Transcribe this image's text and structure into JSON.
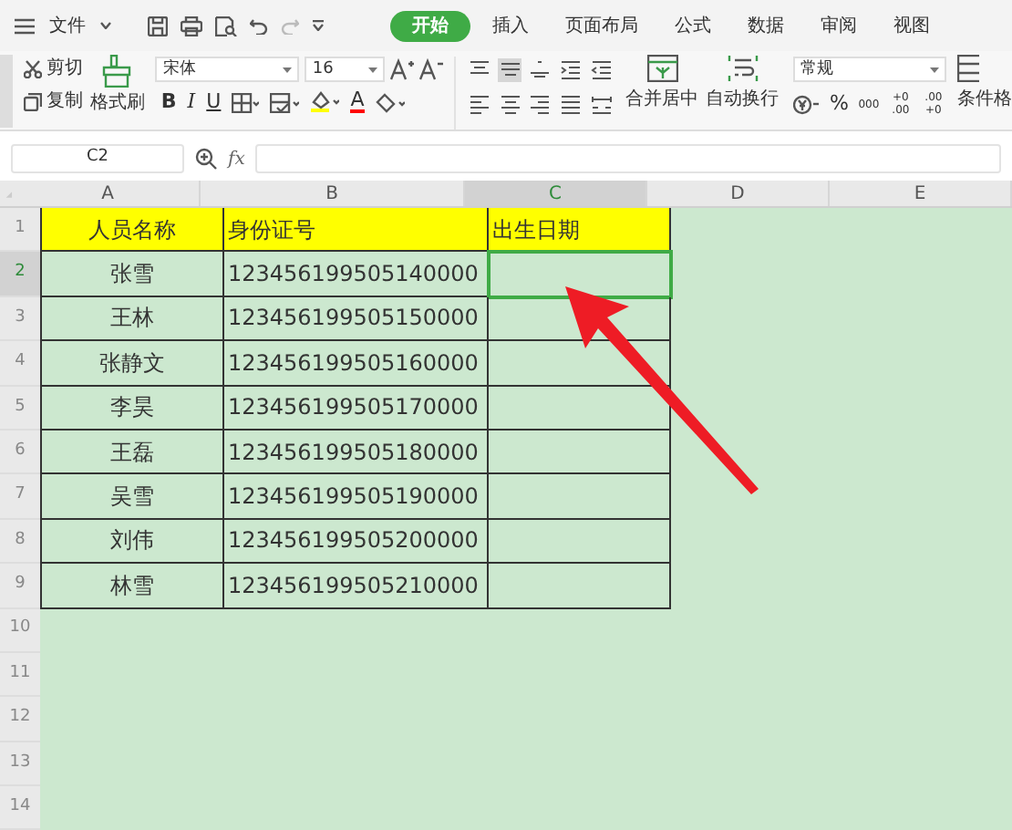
{
  "menu": {
    "file": "文件"
  },
  "tabs": [
    {
      "label": "开始",
      "selected": true
    },
    {
      "label": "插入",
      "selected": false
    },
    {
      "label": "页面布局",
      "selected": false
    },
    {
      "label": "公式",
      "selected": false
    },
    {
      "label": "数据",
      "selected": false
    },
    {
      "label": "审阅",
      "selected": false
    },
    {
      "label": "视图",
      "selected": false
    }
  ],
  "ribbon": {
    "cut": "剪切",
    "copy": "复制",
    "format_painter": "格式刷",
    "font": "宋体",
    "font_size": "16",
    "bold": "B",
    "italic": "I",
    "underline": "U",
    "font_color": "A",
    "align_buttons": [
      {
        "selected": false
      },
      {
        "selected": true
      },
      {
        "selected": false
      },
      {
        "selected": false
      },
      {
        "selected": false
      },
      {
        "selected": false
      },
      {
        "selected": false
      },
      {
        "selected": false
      },
      {
        "selected": false
      },
      {
        "selected": false
      }
    ],
    "merge": "合并居中",
    "wrap": "自动换行",
    "number_format": "常规",
    "percent": "%",
    "thousands": "000",
    "increase_decimal": "+0 .00",
    "decrease_decimal": ".00 +0",
    "conditional": "条件格"
  },
  "name_box": "C2",
  "fx": "fx",
  "columns": [
    {
      "label": "A",
      "selected": false
    },
    {
      "label": "B",
      "selected": false
    },
    {
      "label": "C",
      "selected": true
    },
    {
      "label": "D",
      "selected": false
    },
    {
      "label": "E",
      "selected": false
    }
  ],
  "row_numbers": [
    {
      "label": "1",
      "selected": false
    },
    {
      "label": "2",
      "selected": true
    },
    {
      "label": "3",
      "selected": false
    },
    {
      "label": "4",
      "selected": false
    },
    {
      "label": "5",
      "selected": false
    },
    {
      "label": "6",
      "selected": false
    },
    {
      "label": "7",
      "selected": false
    },
    {
      "label": "8",
      "selected": false
    },
    {
      "label": "9",
      "selected": false
    },
    {
      "label": "10",
      "selected": false
    },
    {
      "label": "11",
      "selected": false
    },
    {
      "label": "12",
      "selected": false
    },
    {
      "label": "13",
      "selected": false
    },
    {
      "label": "14",
      "selected": false
    }
  ],
  "table": {
    "header": [
      "人员名称",
      "身份证号",
      "出生日期"
    ],
    "rows": [
      [
        "张雪",
        "123456199505140000"
      ],
      [
        "王林",
        "123456199505150000"
      ],
      [
        "张静文",
        "123456199505160000"
      ],
      [
        "李昊",
        "123456199505170000"
      ],
      [
        "王磊",
        "123456199505180000"
      ],
      [
        "吴雪",
        "123456199505190000"
      ],
      [
        "刘伟",
        "123456199505200000"
      ],
      [
        "林雪",
        "123456199505210000"
      ]
    ]
  }
}
